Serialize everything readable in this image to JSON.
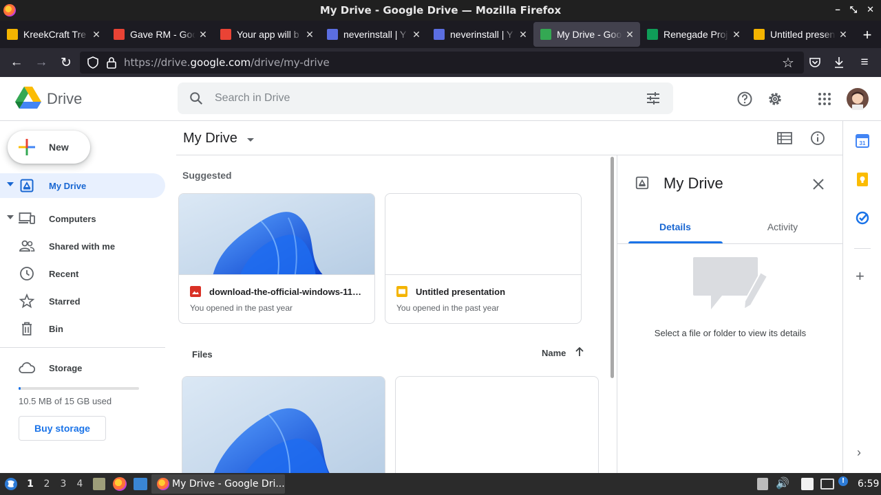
{
  "window": {
    "title": "My Drive - Google Drive — Mozilla Firefox"
  },
  "tabs": [
    {
      "label": "KreekCraft Tre",
      "icon": "tab-favicon-kreekcraft",
      "color": "#f4b400"
    },
    {
      "label": "Gave RM - Goo",
      "icon": "tab-favicon-photos",
      "color": "#ea4335"
    },
    {
      "label": "Your app will b",
      "icon": "tab-favicon-gmail",
      "color": "#ea4335"
    },
    {
      "label": "neverinstall | Y",
      "icon": "tab-favicon-neverinstall",
      "color": "#5b6ee1"
    },
    {
      "label": "neverinstall | Y",
      "icon": "tab-favicon-neverinstall",
      "color": "#5b6ee1"
    },
    {
      "label": "My Drive - Goo",
      "icon": "tab-favicon-drive",
      "color": "#34a853",
      "active": true
    },
    {
      "label": "Renegade Proj",
      "icon": "tab-favicon-sheets",
      "color": "#0f9d58"
    },
    {
      "label": "Untitled presen",
      "icon": "tab-favicon-slides",
      "color": "#f4b400"
    }
  ],
  "navbar": {
    "url_prefix": "https://drive.",
    "url_domain": "google.com",
    "url_path": "/drive/my-drive"
  },
  "header": {
    "app_name": "Drive",
    "search_placeholder": "Search in Drive"
  },
  "sidebar": {
    "new_label": "New",
    "items": [
      {
        "label": "My Drive",
        "selected": true,
        "expandable": true
      },
      {
        "label": "Computers",
        "expandable": true
      },
      {
        "label": "Shared with me"
      },
      {
        "label": "Recent"
      },
      {
        "label": "Starred"
      },
      {
        "label": "Bin"
      }
    ],
    "storage_label": "Storage",
    "storage_used_text": "10.5 MB of 15 GB used",
    "storage_fraction": 0.0007,
    "buy_storage_label": "Buy storage"
  },
  "main": {
    "title": "My Drive",
    "suggested_label": "Suggested",
    "suggested": [
      {
        "name": "download-the-official-windows-11-w...",
        "subtitle": "You opened in the past year",
        "type": "image"
      },
      {
        "name": "Untitled presentation",
        "subtitle": "You opened in the past year",
        "type": "slides"
      }
    ],
    "files_label": "Files",
    "sort_label": "Name"
  },
  "details": {
    "title": "My Drive",
    "tab_details": "Details",
    "tab_activity": "Activity",
    "empty_text": "Select a file or folder to view its details"
  },
  "taskbar": {
    "workspaces": [
      "1",
      "2",
      "3",
      "4"
    ],
    "active_workspace": "1",
    "window_label": "My Drive - Google Dri...",
    "clock": "6:59"
  },
  "colors": {
    "accent": "#1a73e8",
    "selected_bg": "#e8f0fe"
  }
}
